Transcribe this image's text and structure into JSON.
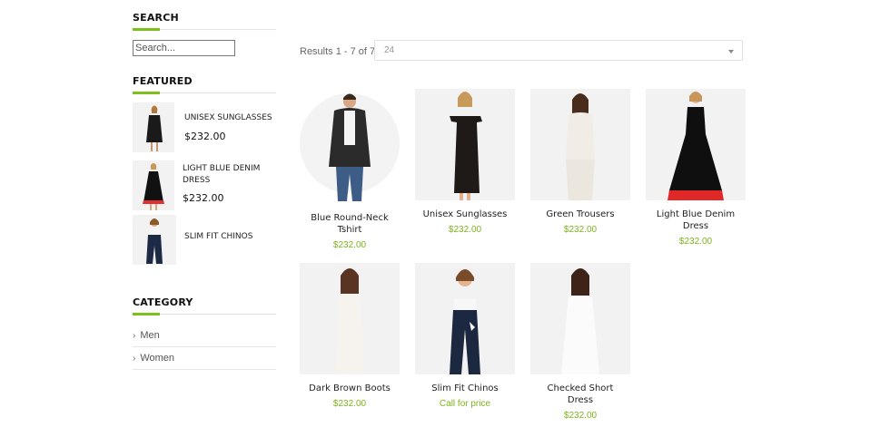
{
  "sidebar": {
    "search": {
      "title": "SEARCH",
      "placeholder": "Search..."
    },
    "featured": {
      "title": "FEATURED",
      "items": [
        {
          "name": "UNISEX SUNGLASSES",
          "price": "$232.00"
        },
        {
          "name": "LIGHT BLUE DENIM DRESS",
          "price": "$232.00"
        },
        {
          "name": "SLIM FIT CHINOS",
          "price": ""
        }
      ]
    },
    "category": {
      "title": "CATEGORY",
      "items": [
        {
          "label": "Men"
        },
        {
          "label": "Women"
        }
      ]
    }
  },
  "toolbar": {
    "results_text": "Results 1 - 7 of 7",
    "per_page_value": "24"
  },
  "products": [
    {
      "name": "Blue Round-Neck Tshirt",
      "price": "$232.00"
    },
    {
      "name": "Unisex Sunglasses",
      "price": "$232.00"
    },
    {
      "name": "Green Trousers",
      "price": "$232.00"
    },
    {
      "name": "Light Blue Denim Dress",
      "price": "$232.00"
    },
    {
      "name": "Dark Brown Boots",
      "price": "$232.00"
    },
    {
      "name": "Slim Fit Chinos",
      "price": "Call for price"
    },
    {
      "name": "Checked Short Dress",
      "price": "$232.00"
    }
  ],
  "colors": {
    "accent": "#7cc11a",
    "price": "#7cb518"
  }
}
